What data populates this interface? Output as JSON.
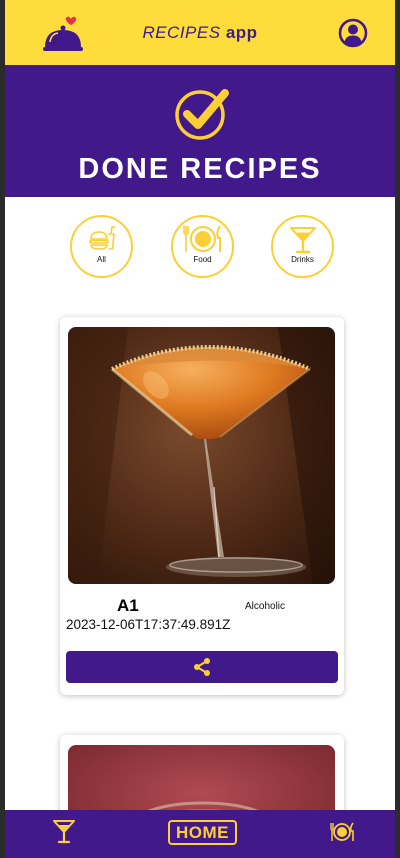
{
  "header": {
    "title_part1": "RECIPES",
    "title_part2": "app",
    "logo_icon": "cloche-heart-icon",
    "profile_icon": "profile-icon"
  },
  "banner": {
    "icon": "check-circle-icon",
    "title": "DONE RECIPES"
  },
  "filters": [
    {
      "label": "All",
      "icon": "fastfood-icon"
    },
    {
      "label": "Food",
      "icon": "plate-cutlery-icon"
    },
    {
      "label": "Drinks",
      "icon": "cocktail-icon"
    }
  ],
  "recipes": [
    {
      "name": "A1",
      "tag": "Alcoholic",
      "done_date": "2023-12-06T17:37:49.891Z",
      "share_icon": "share-icon"
    }
  ],
  "bottom_nav": {
    "home_label": "HOME",
    "drinks_icon": "cocktail-icon",
    "meals_icon": "plate-cutlery-icon"
  },
  "colors": {
    "yellow": "#fddc3c",
    "purple": "#41198a",
    "accent_gold": "#fccf36"
  }
}
